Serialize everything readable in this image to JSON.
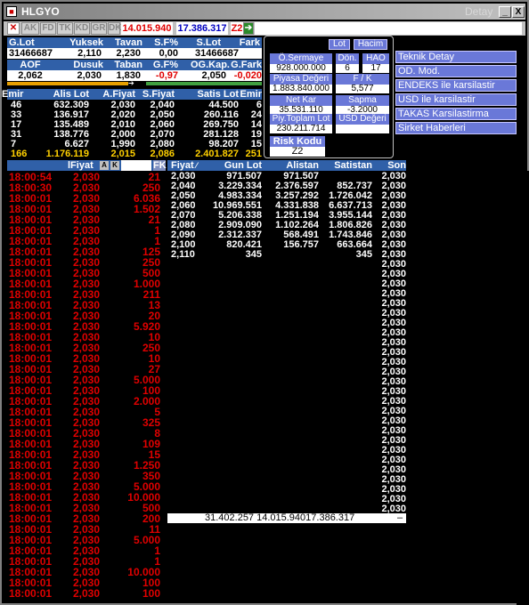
{
  "window": {
    "title": "HLGYO",
    "right_label": "Detay",
    "min": "_",
    "max": "□",
    "close": "X"
  },
  "toolbar": {
    "items": [
      "AK",
      "FD",
      "TK",
      "KD",
      "GR",
      "DK"
    ],
    "value1": "14.015.940",
    "value2": "17.386.317",
    "code": "Z2"
  },
  "summary": {
    "headers1": [
      "G.Lot",
      "Yuksek",
      "Tavan",
      "S.F%",
      "S.Lot",
      "Fark"
    ],
    "values1": [
      "31466687",
      "2,110",
      "2,230",
      "0,00",
      "31466687",
      ""
    ],
    "headers2": [
      "AOF",
      "Dusuk",
      "Taban",
      "G.F%",
      "OG.Kap.",
      "G.Fark"
    ],
    "values2": [
      "2,062",
      "2,030",
      "1,830",
      "-0,97",
      "2,050",
      "-0,020"
    ]
  },
  "depth": {
    "headers": [
      "Emir",
      "Alis Lot",
      "A.Fiyat",
      "S.Fiyat",
      "Satis Lot",
      "Emir"
    ],
    "rows": [
      [
        "46",
        "632.309",
        "2,030",
        "2,040",
        "44.500",
        "6"
      ],
      [
        "33",
        "136.917",
        "2,020",
        "2,050",
        "260.116",
        "24"
      ],
      [
        "17",
        "135.489",
        "2,010",
        "2,060",
        "269.750",
        "14"
      ],
      [
        "31",
        "138.776",
        "2,000",
        "2,070",
        "281.128",
        "19"
      ],
      [
        "7",
        "6.627",
        "1,990",
        "2,080",
        "98.207",
        "15"
      ]
    ],
    "total": [
      "166",
      "1.176.119",
      "2,015",
      "2,086",
      "2.401.827",
      "251"
    ]
  },
  "panel": {
    "btn_lot": "Lot",
    "btn_hacim": "Hacim",
    "osermaye_label": "Ö.Sermaye",
    "osermaye_value": "928.000.000",
    "don_label": "Dön.",
    "don_value": "6",
    "hao_label": "HAO",
    "hao_value": "17",
    "piyasa_label": "Piyasa Değeri",
    "piyasa_value": "1.883.840.000",
    "fk_label": "F / K",
    "fk_value": "5,577",
    "netkar_label": "Net Kar",
    "netkar_value": "35.531.110",
    "sapma_label": "Sapma",
    "sapma_value": "-3.2000",
    "ptl_label": "Piy.Toplam Lot",
    "ptl_value": "230.211.714",
    "usd_label": "USD Değeri",
    "usd_value": "",
    "risk_label": "Risk Kodu",
    "risk_value": "Z2"
  },
  "menu": [
    "Teknik Detay",
    "OD. Mod.",
    "ENDEKS ile karsilastir",
    "USD ile karsilastir",
    "TAKAS Karsilastirma",
    "Sirket Haberleri"
  ],
  "trades": {
    "header_fiyat": "lFiyat",
    "btn_a": "A",
    "btn_k": "K",
    "btn_fk": "FK",
    "rows": [
      [
        "18:00:54",
        "2,030",
        "21"
      ],
      [
        "18:00:30",
        "2,030",
        "250"
      ],
      [
        "18:00:01",
        "2,030",
        "6.036"
      ],
      [
        "18:00:01",
        "2,030",
        "1.502"
      ],
      [
        "18:00:01",
        "2,030",
        "21"
      ],
      [
        "18:00:01",
        "2,030",
        "1"
      ],
      [
        "18:00:01",
        "2,030",
        "1"
      ],
      [
        "18:00:01",
        "2,030",
        "125"
      ],
      [
        "18:00:01",
        "2,030",
        "250"
      ],
      [
        "18:00:01",
        "2,030",
        "500"
      ],
      [
        "18:00:01",
        "2,030",
        "1.000"
      ],
      [
        "18:00:01",
        "2,030",
        "211"
      ],
      [
        "18:00:01",
        "2,030",
        "13"
      ],
      [
        "18:00:01",
        "2,030",
        "20"
      ],
      [
        "18:00:01",
        "2,030",
        "5.920"
      ],
      [
        "18:00:01",
        "2,030",
        "10"
      ],
      [
        "18:00:01",
        "2,030",
        "250"
      ],
      [
        "18:00:01",
        "2,030",
        "10"
      ],
      [
        "18:00:01",
        "2,030",
        "27"
      ],
      [
        "18:00:01",
        "2,030",
        "5.000"
      ],
      [
        "18:00:01",
        "2,030",
        "100"
      ],
      [
        "18:00:01",
        "2,030",
        "2.000"
      ],
      [
        "18:00:01",
        "2,030",
        "5"
      ],
      [
        "18:00:01",
        "2,030",
        "325"
      ],
      [
        "18:00:01",
        "2,030",
        "8"
      ],
      [
        "18:00:01",
        "2,030",
        "109"
      ],
      [
        "18:00:01",
        "2,030",
        "15"
      ],
      [
        "18:00:01",
        "2,030",
        "1.250"
      ],
      [
        "18:00:01",
        "2,030",
        "350"
      ],
      [
        "18:00:01",
        "2,030",
        "5.000"
      ],
      [
        "18:00:01",
        "2,030",
        "10.000"
      ],
      [
        "18:00:01",
        "2,030",
        "500"
      ],
      [
        "18:00:01",
        "2,030",
        "200"
      ],
      [
        "18:00:01",
        "2,030",
        "11"
      ],
      [
        "18:00:01",
        "2,030",
        "5.000"
      ],
      [
        "18:00:01",
        "2,030",
        "1"
      ],
      [
        "18:00:01",
        "2,030",
        "1"
      ],
      [
        "18:00:01",
        "2,030",
        "10.000"
      ],
      [
        "18:00:01",
        "2,030",
        "100"
      ],
      [
        "18:00:01",
        "2,030",
        "100"
      ]
    ]
  },
  "dist": {
    "headers": [
      "Fiyat",
      "Gun Lot",
      "Alistan",
      "Satistan",
      "Son"
    ],
    "rows": [
      [
        "2,030",
        "971.507",
        "971.507",
        ""
      ],
      [
        "2,040",
        "3.229.334",
        "2.376.597",
        "852.737"
      ],
      [
        "2,050",
        "4.983.334",
        "3.257.292",
        "1.726.042"
      ],
      [
        "2,060",
        "10.969.551",
        "4.331.838",
        "6.637.713"
      ],
      [
        "2,070",
        "5.206.338",
        "1.251.194",
        "3.955.144"
      ],
      [
        "2,080",
        "2.909.090",
        "1.102.264",
        "1.806.826"
      ],
      [
        "2,090",
        "2.312.337",
        "568.491",
        "1.743.846"
      ],
      [
        "2,100",
        "820.421",
        "156.757",
        "663.664"
      ],
      [
        "2,110",
        "345",
        "",
        "345"
      ]
    ],
    "son_value": "2,030",
    "total": "31.402.257 14.015.94017.386.317",
    "total_suffix": "–"
  },
  "colors": {
    "header_blue": "#3060a8",
    "trade_red": "#e00000",
    "panel_btn": "#6a78d8"
  }
}
